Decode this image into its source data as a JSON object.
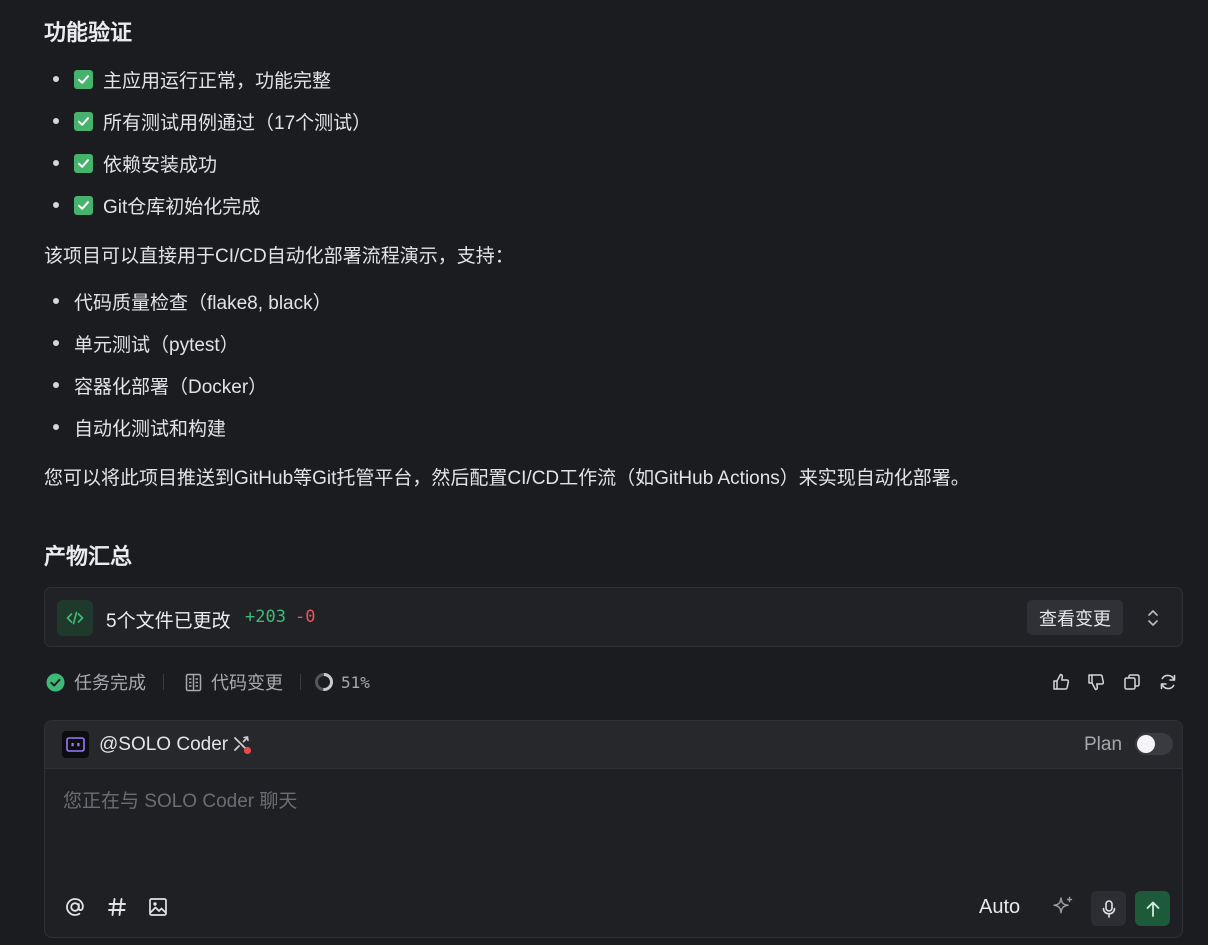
{
  "verify": {
    "title": "功能验证",
    "checks": [
      "主应用运行正常，功能完整",
      "所有测试用例通过（17个测试）",
      "依赖安装成功",
      "Git仓库初始化完成"
    ],
    "intro": "该项目可以直接用于CI/CD自动化部署流程演示，支持：",
    "supports": [
      "代码质量检查（flake8, black）",
      "单元测试（pytest）",
      "容器化部署（Docker）",
      "自动化测试和构建"
    ],
    "closing": "您可以将此项目推送到GitHub等Git托管平台，然后配置CI/CD工作流（如GitHub Actions）来实现自动化部署。"
  },
  "summary": {
    "title": "产物汇总",
    "files_changed": "5个文件已更改",
    "additions": "+203",
    "deletions": "-0",
    "view_label": "查看变更"
  },
  "status": {
    "task_done": "任务完成",
    "code_changes": "代码变更",
    "progress_label": "51%",
    "progress": 0.51,
    "colors": {
      "success": "#3fb978",
      "danger": "#e15a5a"
    }
  },
  "composer": {
    "agent": "@SOLO Coder",
    "plan_label": "Plan",
    "plan_enabled": false,
    "placeholder": "您正在与 SOLO Coder 聊天",
    "model": "Auto"
  }
}
